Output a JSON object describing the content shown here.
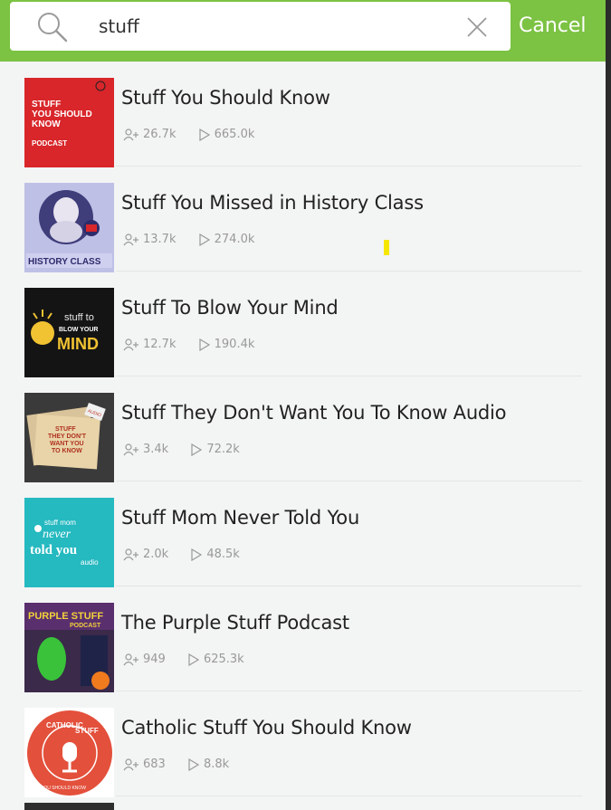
{
  "search": {
    "query": "stuff",
    "cancel_label": "Cancel"
  },
  "results": [
    {
      "title": "Stuff You Should Know",
      "subscribers": "26.7k",
      "plays": "665.0k",
      "art": {
        "bg": "#d8262a",
        "line1": "STUFF",
        "line2": "YOU SHOULD",
        "line3": "KNOW",
        "tag": "PODCAST"
      }
    },
    {
      "title": "Stuff You Missed in History Class",
      "subscribers": "13.7k",
      "plays": "274.0k",
      "art": {
        "bg": "#bfc0e6",
        "caption": "HISTORY CLASS"
      }
    },
    {
      "title": "Stuff To Blow Your Mind",
      "subscribers": "12.7k",
      "plays": "190.4k",
      "art": {
        "bg": "#141414",
        "line1": "stuff to",
        "line2": "BLOW YOUR",
        "line3": "MIND"
      }
    },
    {
      "title": "Stuff They Don't Want You To Know Audio",
      "subscribers": "3.4k",
      "plays": "72.2k",
      "art": {
        "bg": "#3a3a3a",
        "line1": "STUFF",
        "line2": "THEY DON'T",
        "line3": "WANT YOU",
        "line4": "TO KNOW",
        "tag": "AUDIO"
      }
    },
    {
      "title": "Stuff Mom Never Told You",
      "subscribers": "2.0k",
      "plays": "48.5k",
      "art": {
        "bg": "#25b9c0",
        "line1": "stuff mom",
        "line2": "never",
        "line3": "told you",
        "tag": "audio"
      }
    },
    {
      "title": "The Purple Stuff Podcast",
      "subscribers": "949",
      "plays": "625.3k",
      "art": {
        "bg": "#3b2a4a",
        "line1": "PURPLE STUFF",
        "tag": "PODCAST"
      }
    },
    {
      "title": "Catholic Stuff You Should Know",
      "subscribers": "683",
      "plays": "8.8k",
      "art": {
        "bg": "#ffffff",
        "ring": "#e3503b",
        "line1": "CATHOLIC",
        "line2": "STUFF",
        "line3": "YOU SHOULD KNOW"
      }
    }
  ]
}
